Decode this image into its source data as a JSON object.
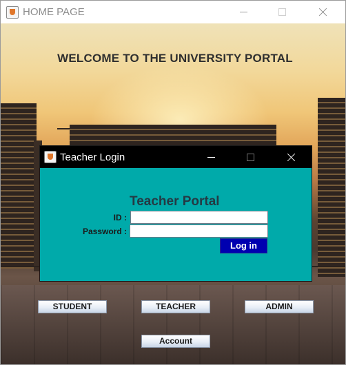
{
  "main_window": {
    "title": "HOME PAGE",
    "app_icon": "java-coffee-icon",
    "controls": [
      "minimize",
      "maximize",
      "close"
    ]
  },
  "welcome_text": "WELCOME TO THE UNIVERSITY PORTAL",
  "nav_buttons": {
    "student": "STUDENT",
    "teacher": "TEACHER",
    "admin": "ADMIN",
    "account": "Account"
  },
  "dialog": {
    "title": "Teacher Login",
    "app_icon": "java-coffee-icon",
    "heading": "Teacher Portal",
    "id_label": "ID :",
    "id_value": "",
    "password_label": "Password :",
    "password_value": "",
    "login_button": "Log in"
  },
  "colors": {
    "dialog_background": "#00aaaa",
    "dialog_titlebar": "#000000",
    "login_button": "#0000b0",
    "heading_text": "#243a44"
  }
}
